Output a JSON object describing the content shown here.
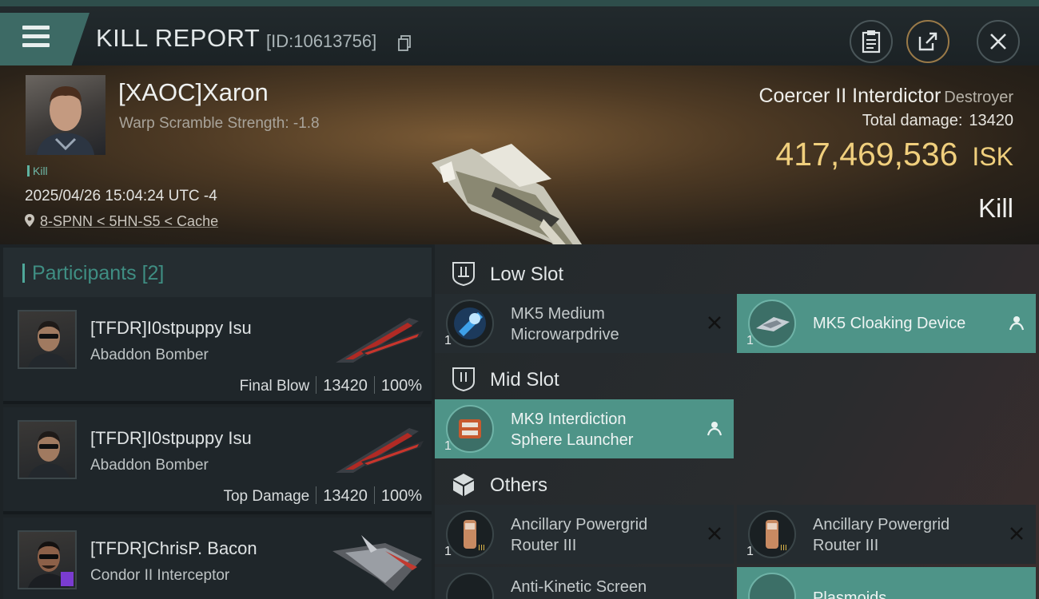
{
  "header": {
    "title": "KILL REPORT",
    "report_id": "[ID:10613756]"
  },
  "victim": {
    "name": "[XAOC]Xaron",
    "subtitle": "Warp Scramble Strength: -1.8",
    "tag": "Kill",
    "datetime": "2025/04/26 15:04:24 UTC -4",
    "location": "8-SPNN < 5HN-S5 < Cache",
    "ship_name": "Coercer II Interdictor",
    "ship_class": "Destroyer",
    "total_damage_label": "Total damage:",
    "total_damage": "13420",
    "isk_value": "417,469,536",
    "isk_unit": "ISK",
    "result": "Kill"
  },
  "participants": {
    "label": "Participants",
    "count": "[2]",
    "items": [
      {
        "name": "[TFDR]I0stpuppy Isu",
        "ship": "Abaddon Bomber",
        "role": "Final Blow",
        "damage": "13420",
        "percent": "100%"
      },
      {
        "name": "[TFDR]I0stpuppy Isu",
        "ship": "Abaddon Bomber",
        "role": "Top Damage",
        "damage": "13420",
        "percent": "100%"
      },
      {
        "name": "[TFDR]ChrisP. Bacon",
        "ship": "Condor II Interceptor",
        "role": "",
        "damage": "",
        "percent": ""
      }
    ]
  },
  "fitting": {
    "low_slot": {
      "label": "Low Slot",
      "modules": [
        {
          "name_line1": "MK5 Medium",
          "name_line2": "Microwarpdrive",
          "qty": "1",
          "state": "destroyed"
        },
        {
          "name_line1": "MK5 Cloaking Device",
          "name_line2": "",
          "qty": "1",
          "state": "dropped"
        }
      ]
    },
    "mid_slot": {
      "label": "Mid Slot",
      "modules": [
        {
          "name_line1": "MK9 Interdiction",
          "name_line2": "Sphere Launcher",
          "qty": "1",
          "state": "dropped"
        }
      ]
    },
    "others": {
      "label": "Others",
      "modules": [
        {
          "name_line1": "Ancillary Powergrid",
          "name_line2": "Router III",
          "qty": "1",
          "state": "destroyed"
        },
        {
          "name_line1": "Ancillary Powergrid",
          "name_line2": "Router III",
          "qty": "1",
          "state": "destroyed"
        },
        {
          "name_line1": "Anti-Kinetic Screen",
          "name_line2": "",
          "qty": "",
          "state": "destroyed"
        },
        {
          "name_line1": "Plasmoids",
          "name_line2": "",
          "qty": "",
          "state": "dropped"
        }
      ]
    }
  },
  "colors": {
    "accent_teal": "#4e9488",
    "isk_gold": "#f0cf7d",
    "menu_teal": "#3d6a65"
  }
}
